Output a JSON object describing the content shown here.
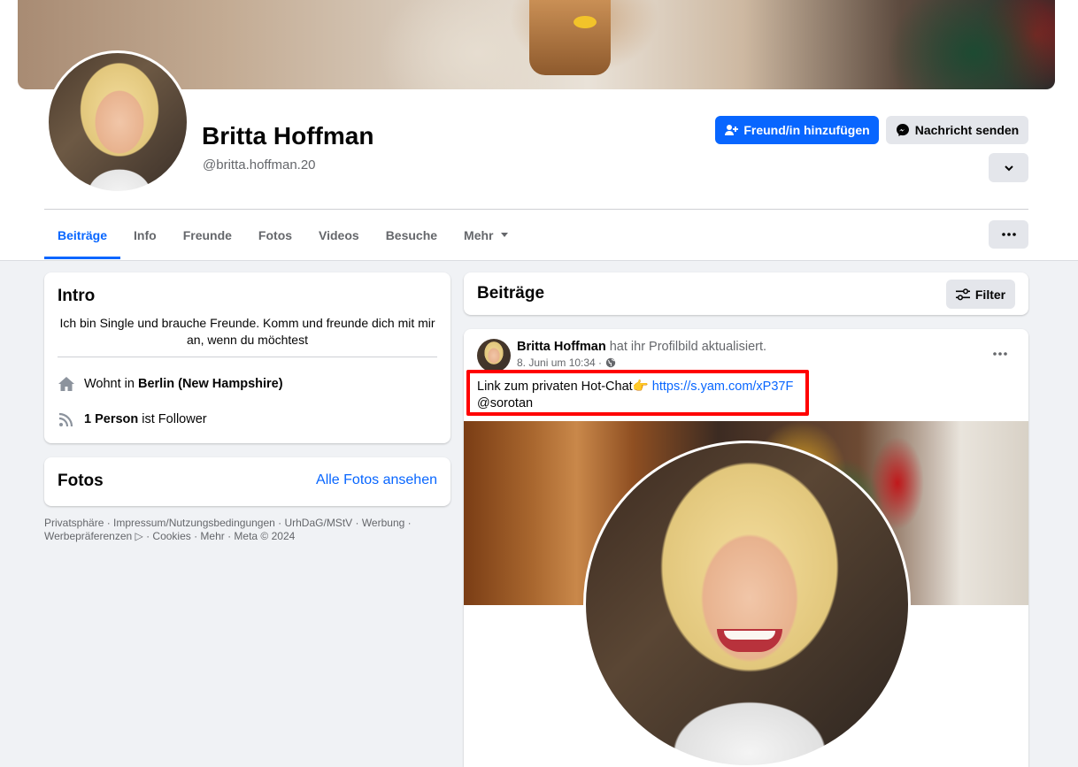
{
  "profile": {
    "name": "Britta Hoffman",
    "handle": "@britta.hoffman.20"
  },
  "actions": {
    "add_friend": "Freund/in hinzufügen",
    "send_message": "Nachricht senden"
  },
  "tabs": [
    {
      "label": "Beiträge",
      "active": true
    },
    {
      "label": "Info"
    },
    {
      "label": "Freunde"
    },
    {
      "label": "Fotos"
    },
    {
      "label": "Videos"
    },
    {
      "label": "Besuche"
    },
    {
      "label": "Mehr"
    }
  ],
  "intro": {
    "title": "Intro",
    "bio": "Ich bin Single und brauche Freunde. Komm und freunde dich mit mir an, wenn du möchtest",
    "lives_prefix": "Wohnt in ",
    "lives_location": "Berlin (New Hampshire)",
    "followers_count": "1 Person",
    "followers_suffix": " ist Follower"
  },
  "photos": {
    "title": "Fotos",
    "see_all": "Alle Fotos ansehen"
  },
  "footer": {
    "line1": "Privatsphäre · Impressum/Nutzungsbedingungen · UrhDaG/MStV · Werbung ·",
    "line2": "Werbepräferenzen ▷ · Cookies · Mehr · Meta © 2024"
  },
  "posts_section": {
    "title": "Beiträge",
    "filter": "Filter"
  },
  "post": {
    "author": "Britta Hoffman",
    "action": " hat ihr Profilbild aktualisiert.",
    "date": "8. Juni um 10:34 ·",
    "text_prefix": "Link zum privaten Hot-Chat👉 ",
    "url": "https://s.yam.com/xP37F",
    "mention": "@sorotan"
  },
  "colors": {
    "accent": "#0866ff",
    "highlight_box": "#ff0000"
  }
}
